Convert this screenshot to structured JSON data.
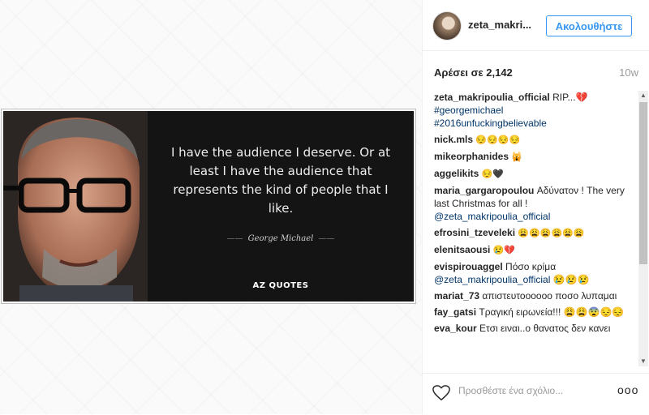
{
  "post": {
    "quote": "I have the audience I deserve. Or at least I have the audience that represents the kind of people that I like.",
    "author": "George Michael",
    "brand": "AZ QUOTES"
  },
  "header": {
    "username": "zeta_makri...",
    "follow_label": "Ακολουθήστε"
  },
  "likes": {
    "text": "Αρέσει σε 2,142",
    "time": "10w"
  },
  "comments": [
    {
      "user": "zeta_makripoulia_official",
      "text": "RIP...💔",
      "links": [
        "#georgemichael",
        "#2016unfuckingbelievable"
      ]
    },
    {
      "user": "nick.mls",
      "text": "😔😔😔😔",
      "links": []
    },
    {
      "user": "mikeorphanides",
      "text": "🙀",
      "links": []
    },
    {
      "user": "aggelikits",
      "text": "😔🖤",
      "links": []
    },
    {
      "user": "maria_gargaropoulou",
      "text": "Αδύνατον ! The very last Christmas for all !",
      "links": [
        "@zeta_makripoulia_official"
      ]
    },
    {
      "user": "efrosini_tzeveleki",
      "text": "😩😩😩😩😩😩",
      "links": []
    },
    {
      "user": "elenitsaousi",
      "text": "😢💔",
      "links": []
    },
    {
      "user": "evispirouaggel",
      "text": "Πόσο κρίμα",
      "links": [
        "@zeta_makripoulia_official 😢😢😢"
      ]
    },
    {
      "user": "mariat_73",
      "text": "απιστευτοοοοοο ποσο λυπαμαι",
      "links": []
    },
    {
      "user": "fay_gatsi",
      "text": "Τραγική ειρωνεία!!! 😩😩😨😔😔",
      "links": []
    },
    {
      "user": "eva_kour",
      "text": "Ετσι ειναι..ο θανατος δεν κανει",
      "links": []
    }
  ],
  "footer": {
    "comment_placeholder": "Προσθέστε ένα σχόλιο...",
    "more_label": "ooo"
  },
  "colors": {
    "accent": "#3897f0",
    "link": "#003569"
  },
  "icons": [
    "heart-icon",
    "more-options-icon",
    "scroll-up-icon",
    "scroll-down-icon"
  ]
}
